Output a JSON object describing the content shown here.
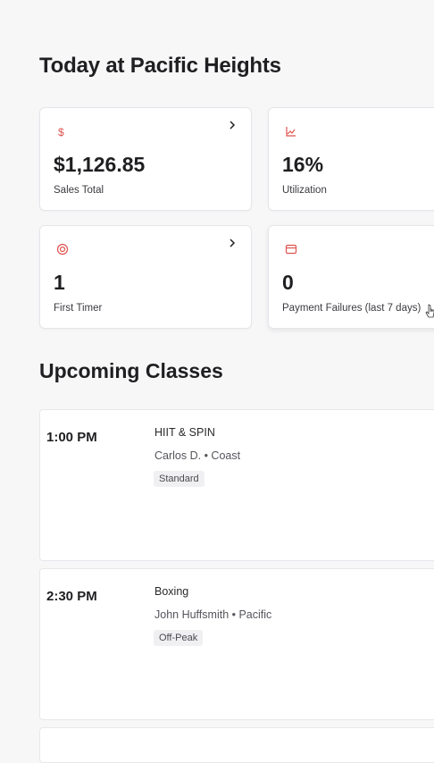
{
  "page": {
    "title": "Today at Pacific Heights"
  },
  "colors": {
    "accent": "#e0524f",
    "background": "#f7f7f8"
  },
  "stats": [
    {
      "icon": "dollar-icon",
      "value": "$1,126.85",
      "label": "Sales Total",
      "has_chevron": true
    },
    {
      "icon": "chart-line-icon",
      "value": "16%",
      "label": "Utilization",
      "has_chevron": false
    },
    {
      "icon": "target-icon",
      "value": "1",
      "label": "First Timer",
      "has_chevron": true
    },
    {
      "icon": "credit-card-icon",
      "value": "0",
      "label": "Payment Failures (last 7 days)",
      "has_chevron": false
    }
  ],
  "upcoming": {
    "title": "Upcoming Classes",
    "classes": [
      {
        "time": "1:00 PM",
        "name": "HIIT & SPIN",
        "instructor_location": "Carlos D. • Coast",
        "tag": "Standard"
      },
      {
        "time": "2:30 PM",
        "name": "Boxing",
        "instructor_location": "John Huffsmith • Pacific",
        "tag": "Off-Peak"
      }
    ]
  }
}
